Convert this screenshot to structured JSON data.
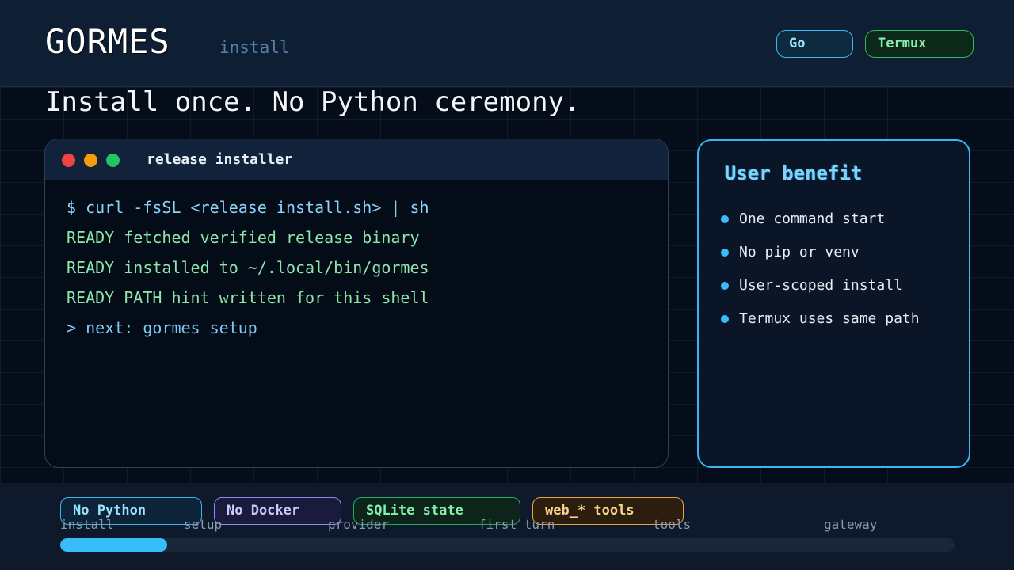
{
  "header": {
    "brand": "GORMES",
    "subtitle": "install",
    "pills": [
      {
        "label": "Go",
        "color": "#3bb8f2"
      },
      {
        "label": "Termux",
        "color": "#2fb866"
      }
    ]
  },
  "headline": "Install once. No Python ceremony.",
  "terminal": {
    "title": "release installer",
    "lines": [
      "$ curl -fsSL <release install.sh> | sh",
      "READY fetched verified release binary",
      "READY installed to ~/.local/bin/gormes",
      "READY PATH hint written for this shell",
      "> next: gormes setup"
    ]
  },
  "panel": {
    "title": "User benefit",
    "items": [
      "One command start",
      "No pip or venv",
      "User-scoped install",
      "Termux uses same path"
    ]
  },
  "footer": {
    "chips": [
      "No Python",
      "No Docker",
      "SQLite state",
      "web_* tools"
    ],
    "steps": [
      "install",
      "setup",
      "provider",
      "first turn",
      "tools",
      "gateway"
    ],
    "progress": 0.12
  },
  "colors": {
    "accent": "#38bdf8",
    "ready": "#8ee6a8",
    "background": "#050d1a"
  }
}
